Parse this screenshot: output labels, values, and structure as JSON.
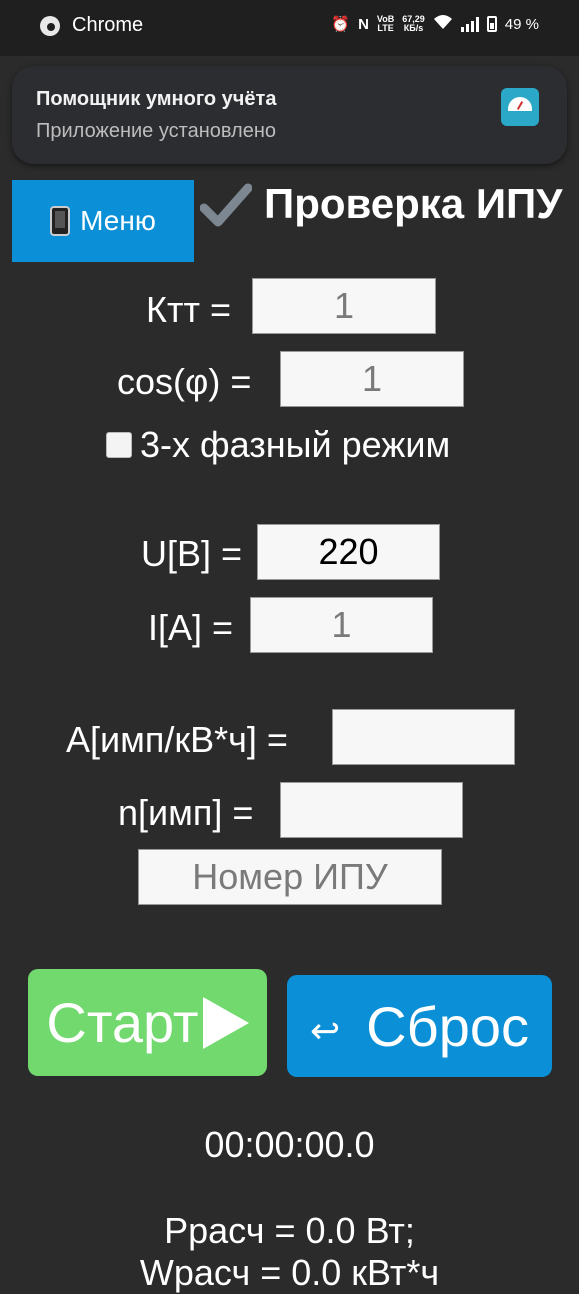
{
  "status_bar": {
    "app": "Chrome",
    "net_speed": "67,29",
    "net_unit": "КБ/s",
    "network_label_top": "VoB",
    "network_label_bottom": "LTE",
    "battery": "49 %"
  },
  "notification": {
    "title": "Помощник умного учёта",
    "subtitle": "Приложение установлено",
    "icon": "meter-gauge-icon"
  },
  "header": {
    "menu_label": "Меню",
    "title": "Проверка ИПУ"
  },
  "form": {
    "ktt_label": "Ктт =",
    "ktt_placeholder": "1",
    "cos_label": "cos(φ) =",
    "cos_placeholder": "1",
    "three_phase_label": "3-х фазный режим",
    "three_phase_checked": false,
    "u_label": "U[В] =",
    "u_value": "220",
    "i_label": "I[А] =",
    "i_placeholder": "1",
    "a_label": "A[имп/кВ*ч] =",
    "a_value": "",
    "n_label": "n[имп] =",
    "n_value": "",
    "ipu_placeholder": "Номер ИПУ"
  },
  "buttons": {
    "start": "Старт",
    "reset": "Сброс",
    "reset_glyph": "↩"
  },
  "results": {
    "timer": "00:00:00.0",
    "p_calc": "Pрасч = 0.0 Вт;",
    "w_calc": "Wрасч = 0.0 кВт*ч"
  },
  "colors": {
    "background": "#2b2b2b",
    "accent_blue": "#0b8fd6",
    "start_green": "#72d96f"
  }
}
